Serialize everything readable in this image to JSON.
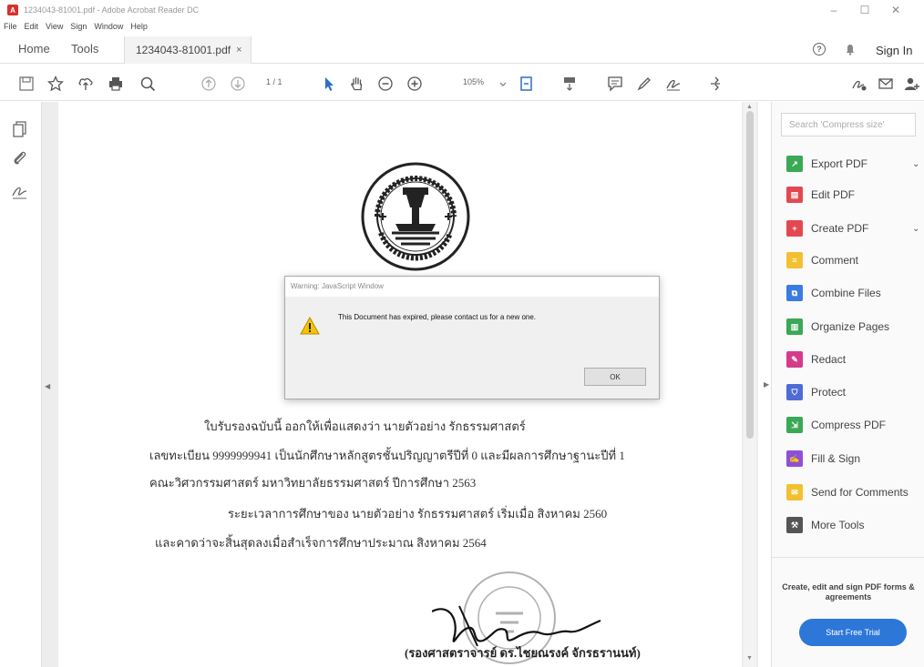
{
  "window": {
    "title": "1234043-81001.pdf - Adobe Acrobat Reader DC",
    "minimize": "–",
    "maximize": "☐",
    "close": "✕"
  },
  "menu": [
    "File",
    "Edit",
    "View",
    "Sign",
    "Window",
    "Help"
  ],
  "tabs": {
    "home": "Home",
    "tools": "Tools",
    "document": "1234043-81001.pdf",
    "document_close": "×",
    "sign_in": "Sign In"
  },
  "toolbar": {
    "page_indicator": "1 / 1",
    "zoom": "105%"
  },
  "document": {
    "lines": [
      "ใบรับรองฉบับนี้ ออกให้เพื่อแสดงว่า นายตัวอย่าง  รักธรรมศาสตร์",
      "เลขทะเบียน 9999999941 เป็นนักศึกษาหลักสูตรชั้นปริญญาตรีปีที่ 0 และมีผลการศึกษาฐานะปีที่ 1",
      "คณะวิศวกรรมศาสตร์ มหาวิทยาลัยธรรมศาสตร์ ปีการศึกษา 2563",
      "ระยะเวลาการศึกษาของ นายตัวอย่าง  รักธรรมศาสตร์  เริ่มเมื่อ สิงหาคม 2560",
      "และคาดว่าจะสิ้นสุดลงเมื่อสำเร็จการศึกษาประมาณ สิงหาคม 2564"
    ],
    "signatory": "(รองศาสตราจารย์ ดร.ไชยณรงค์ จักรธรานนท์)"
  },
  "dialog": {
    "title": "Warning: JavaScript Window",
    "message": "This Document has expired, please contact us for a new one.",
    "ok_label": "OK"
  },
  "right_panel": {
    "search_placeholder": "Search 'Compress size'",
    "tools": [
      {
        "label": "Export PDF",
        "color": "#3aa855",
        "icon": "export-pdf-icon",
        "chevron": true
      },
      {
        "label": "Edit PDF",
        "color": "#e34850",
        "icon": "edit-pdf-icon",
        "chevron": false
      },
      {
        "label": "Create PDF",
        "color": "#e34850",
        "icon": "create-pdf-icon",
        "chevron": true
      },
      {
        "label": "Comment",
        "color": "#f3c031",
        "icon": "comment-icon",
        "chevron": false
      },
      {
        "label": "Combine Files",
        "color": "#3c7be0",
        "icon": "combine-files-icon",
        "chevron": false
      },
      {
        "label": "Organize Pages",
        "color": "#3aa855",
        "icon": "organize-pages-icon",
        "chevron": false
      },
      {
        "label": "Redact",
        "color": "#d43c8a",
        "icon": "redact-icon",
        "chevron": false
      },
      {
        "label": "Protect",
        "color": "#4f6bd6",
        "icon": "protect-icon",
        "chevron": false
      },
      {
        "label": "Compress PDF",
        "color": "#3aa855",
        "icon": "compress-pdf-icon",
        "chevron": false
      },
      {
        "label": "Fill & Sign",
        "color": "#8f4fd6",
        "icon": "fill-sign-icon",
        "chevron": false
      },
      {
        "label": "Send for Comments",
        "color": "#f3c031",
        "icon": "send-comments-icon",
        "chevron": false
      },
      {
        "label": "More Tools",
        "color": "#555555",
        "icon": "more-tools-icon",
        "chevron": false
      }
    ],
    "promo_text": "Create, edit and sign PDF forms & agreements",
    "trial_button": "Start Free Trial"
  }
}
